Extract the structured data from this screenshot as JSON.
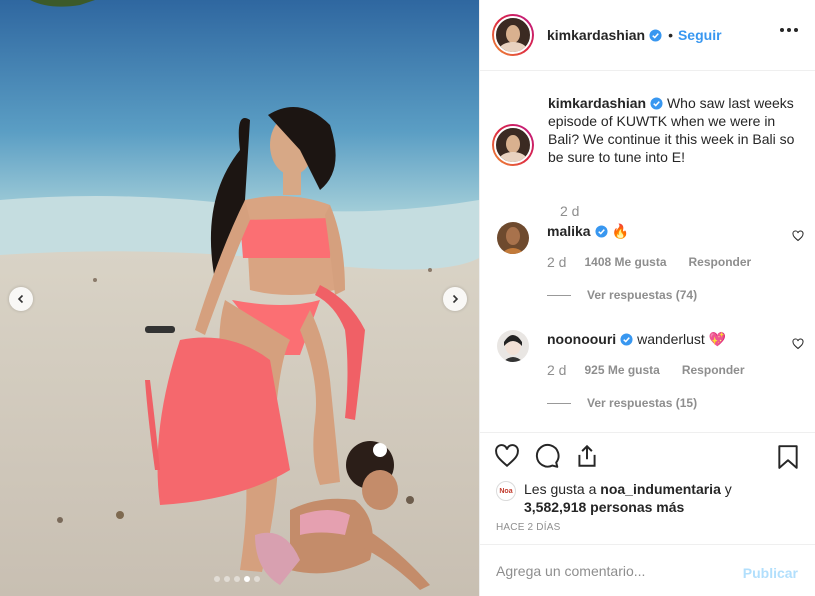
{
  "post": {
    "username": "kimkardashian",
    "separator": "•",
    "follow_label": "Seguir",
    "caption": "Who saw last weeks episode of KUWTK when we were in Bali? We continue it this week in Bali so be sure to tune into E!",
    "caption_age": "2 d",
    "comments": [
      {
        "username": "malika",
        "text": "🔥",
        "age": "2 d",
        "likes": "1408 Me gusta",
        "reply_label": "Responder",
        "view_replies": "Ver respuestas (74)"
      },
      {
        "username": "noonoouri",
        "text": "wanderlust 💖",
        "age": "2 d",
        "likes": "925 Me gusta",
        "reply_label": "Responder",
        "view_replies": "Ver respuestas (15)"
      }
    ],
    "likes_line": {
      "prefix": "Les gusta a ",
      "liker": "noa_indumentaria",
      "middle": " y ",
      "count": "3,582,918 personas más"
    },
    "liker_avatar_text": "Noa",
    "timestamp": "HACE 2 DÍAS",
    "comment_placeholder": "Agrega un comentario...",
    "publish_label": "Publicar",
    "carousel": {
      "slides": 5,
      "active_index": 3
    }
  },
  "icons": {
    "verified": "verified-badge-icon",
    "more": "more-options-icon",
    "like": "heart-icon",
    "comment": "comment-bubble-icon",
    "share": "share-icon",
    "save": "bookmark-icon",
    "prev": "chevron-left-icon",
    "next": "chevron-right-icon"
  },
  "colors": {
    "link": "#3897f0",
    "muted": "#8e8e8e",
    "publish_disabled": "#b2dffc",
    "text": "#262626",
    "verified": "#3897f0"
  }
}
